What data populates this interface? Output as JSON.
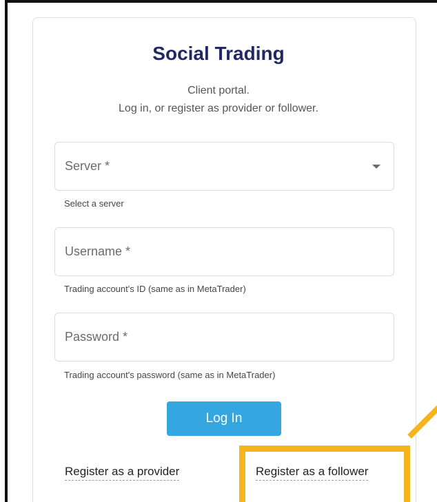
{
  "card": {
    "title": "Social Trading",
    "subtitle_line1": "Client portal.",
    "subtitle_line2": "Log in, or register as provider or follower."
  },
  "form": {
    "server": {
      "label": "Server *",
      "helper": "Select a server"
    },
    "username": {
      "label": "Username *",
      "helper": "Trading account's ID (same as in MetaTrader)"
    },
    "password": {
      "label": "Password *",
      "helper": "Trading account's password (same as in MetaTrader)"
    },
    "login_label": "Log In"
  },
  "links": {
    "provider": "Register as a provider",
    "follower": "Register as a follower"
  },
  "colors": {
    "title": "#1f2a63",
    "button": "#34a7e0",
    "highlight": "#f5b31c"
  },
  "icons": {
    "server_dropdown": "caret-down-icon"
  }
}
